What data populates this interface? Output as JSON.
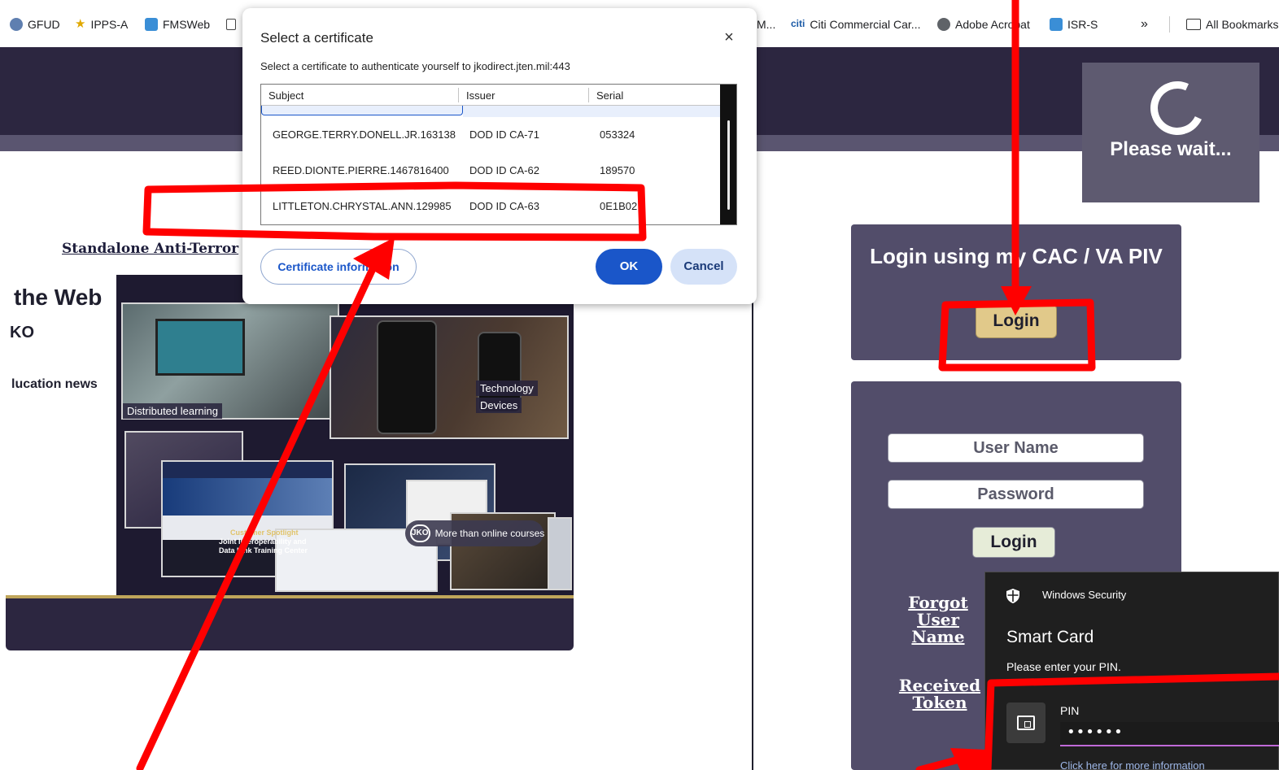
{
  "bookmarks_bar": {
    "items": [
      {
        "label": "GFUD",
        "icon": "globe-icon"
      },
      {
        "label": "IPPS-A",
        "icon": "army-star-icon"
      },
      {
        "label": "FMSWeb",
        "icon": "fmsweb-icon"
      },
      {
        "label": "",
        "icon": "document-icon"
      },
      {
        "label": "M...",
        "icon": ""
      },
      {
        "label": "Citi Commercial Car...",
        "icon": "citi-icon"
      },
      {
        "label": "Adobe Acrobat",
        "icon": "globe-icon"
      },
      {
        "label": "ISR-S",
        "icon": "fmsweb-icon"
      }
    ],
    "overflow": "»",
    "all_bookmarks": "All Bookmarks"
  },
  "header": {
    "please_wait": "Please wait..."
  },
  "left": {
    "standalone_link": "Standalone Anti-Terror",
    "heading": "the Web",
    "subheading": "KO",
    "education_news": "lucation news",
    "collage": {
      "caption_distributed": "Distributed learning",
      "caption_technology": "Technology",
      "caption_devices": "Devices",
      "spotlight_title": "Customer Spotlight",
      "spotlight_body": "Joint Interoperability and Data Link Training Center",
      "jko_logo": "JKO",
      "jko_tagline": "More than online courses"
    }
  },
  "cac_panel": {
    "title": "Login using my CAC / VA PIV",
    "login_label": "Login"
  },
  "login_panel": {
    "username_placeholder": "User Name",
    "password_placeholder": "Password",
    "login_label": "Login",
    "forgot_link": "Forgot User Name",
    "received_link": "Received Token"
  },
  "cert_dialog": {
    "title": "Select a certificate",
    "close": "×",
    "description": "Select a certificate to authenticate yourself to jkodirect.jten.mil:443",
    "columns": [
      "Subject",
      "Issuer",
      "Serial"
    ],
    "rows": [
      {
        "subject": "GEORGE.TERRY.DONELL.JR.163138",
        "issuer": "DOD ID CA-71",
        "serial": "053324"
      },
      {
        "subject": "REED.DIONTE.PIERRE.1467816400",
        "issuer": "DOD ID CA-62",
        "serial": "189570"
      },
      {
        "subject": "LITTLETON.CHRYSTAL.ANN.129985",
        "issuer": "DOD ID CA-63",
        "serial": "0E1B02"
      }
    ],
    "cert_info_button": "Certificate information",
    "ok_button": "OK",
    "cancel_button": "Cancel"
  },
  "windows_security": {
    "app_name": "Windows Security",
    "title": "Smart Card",
    "message": "Please enter your PIN.",
    "pin_label": "PIN",
    "pin_value": "••••••",
    "more_info": "Click here for more information"
  },
  "colors": {
    "site_dark": "#2c2640",
    "panel": "#524d6a",
    "annotation_red": "#ff0000",
    "dialog_accent": "#1a56c9"
  }
}
